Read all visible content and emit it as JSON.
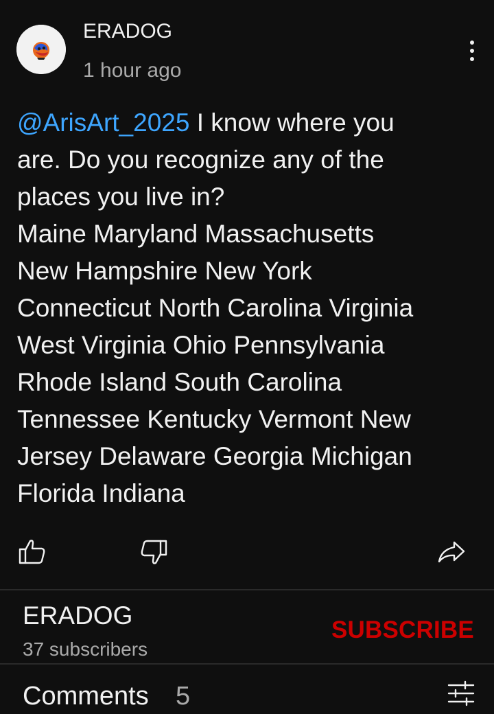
{
  "comment": {
    "author": "ERADOG",
    "time": "1 hour ago",
    "mention": "@ArisArt_2025",
    "lines": [
      " I know where you",
      "are. Do you recognize any of the",
      "places you live in?",
      "Maine Maryland Massachusetts",
      "New Hampshire New York",
      "Connecticut North Carolina Virginia",
      "West Virginia Ohio Pennsylvania",
      "Rhode Island South Carolina",
      "Tennessee Kentucky Vermont New",
      "Jersey Delaware Georgia Michigan",
      "Florida Indiana"
    ]
  },
  "channel": {
    "name": "ERADOG",
    "subscribers": "37 subscribers",
    "subscribe_label": "SUBSCRIBE"
  },
  "comments_section": {
    "title": "Comments",
    "count": "5"
  },
  "icons": {
    "avatar": "avatar-icon",
    "more": "more-vertical-icon",
    "like": "thumbs-up-icon",
    "dislike": "thumbs-down-icon",
    "share": "share-icon",
    "filter": "sliders-icon"
  },
  "colors": {
    "background": "#0f0f0f",
    "mention": "#3ea6ff",
    "subscribe": "#cc0000",
    "secondary_text": "#aaaaaa"
  }
}
